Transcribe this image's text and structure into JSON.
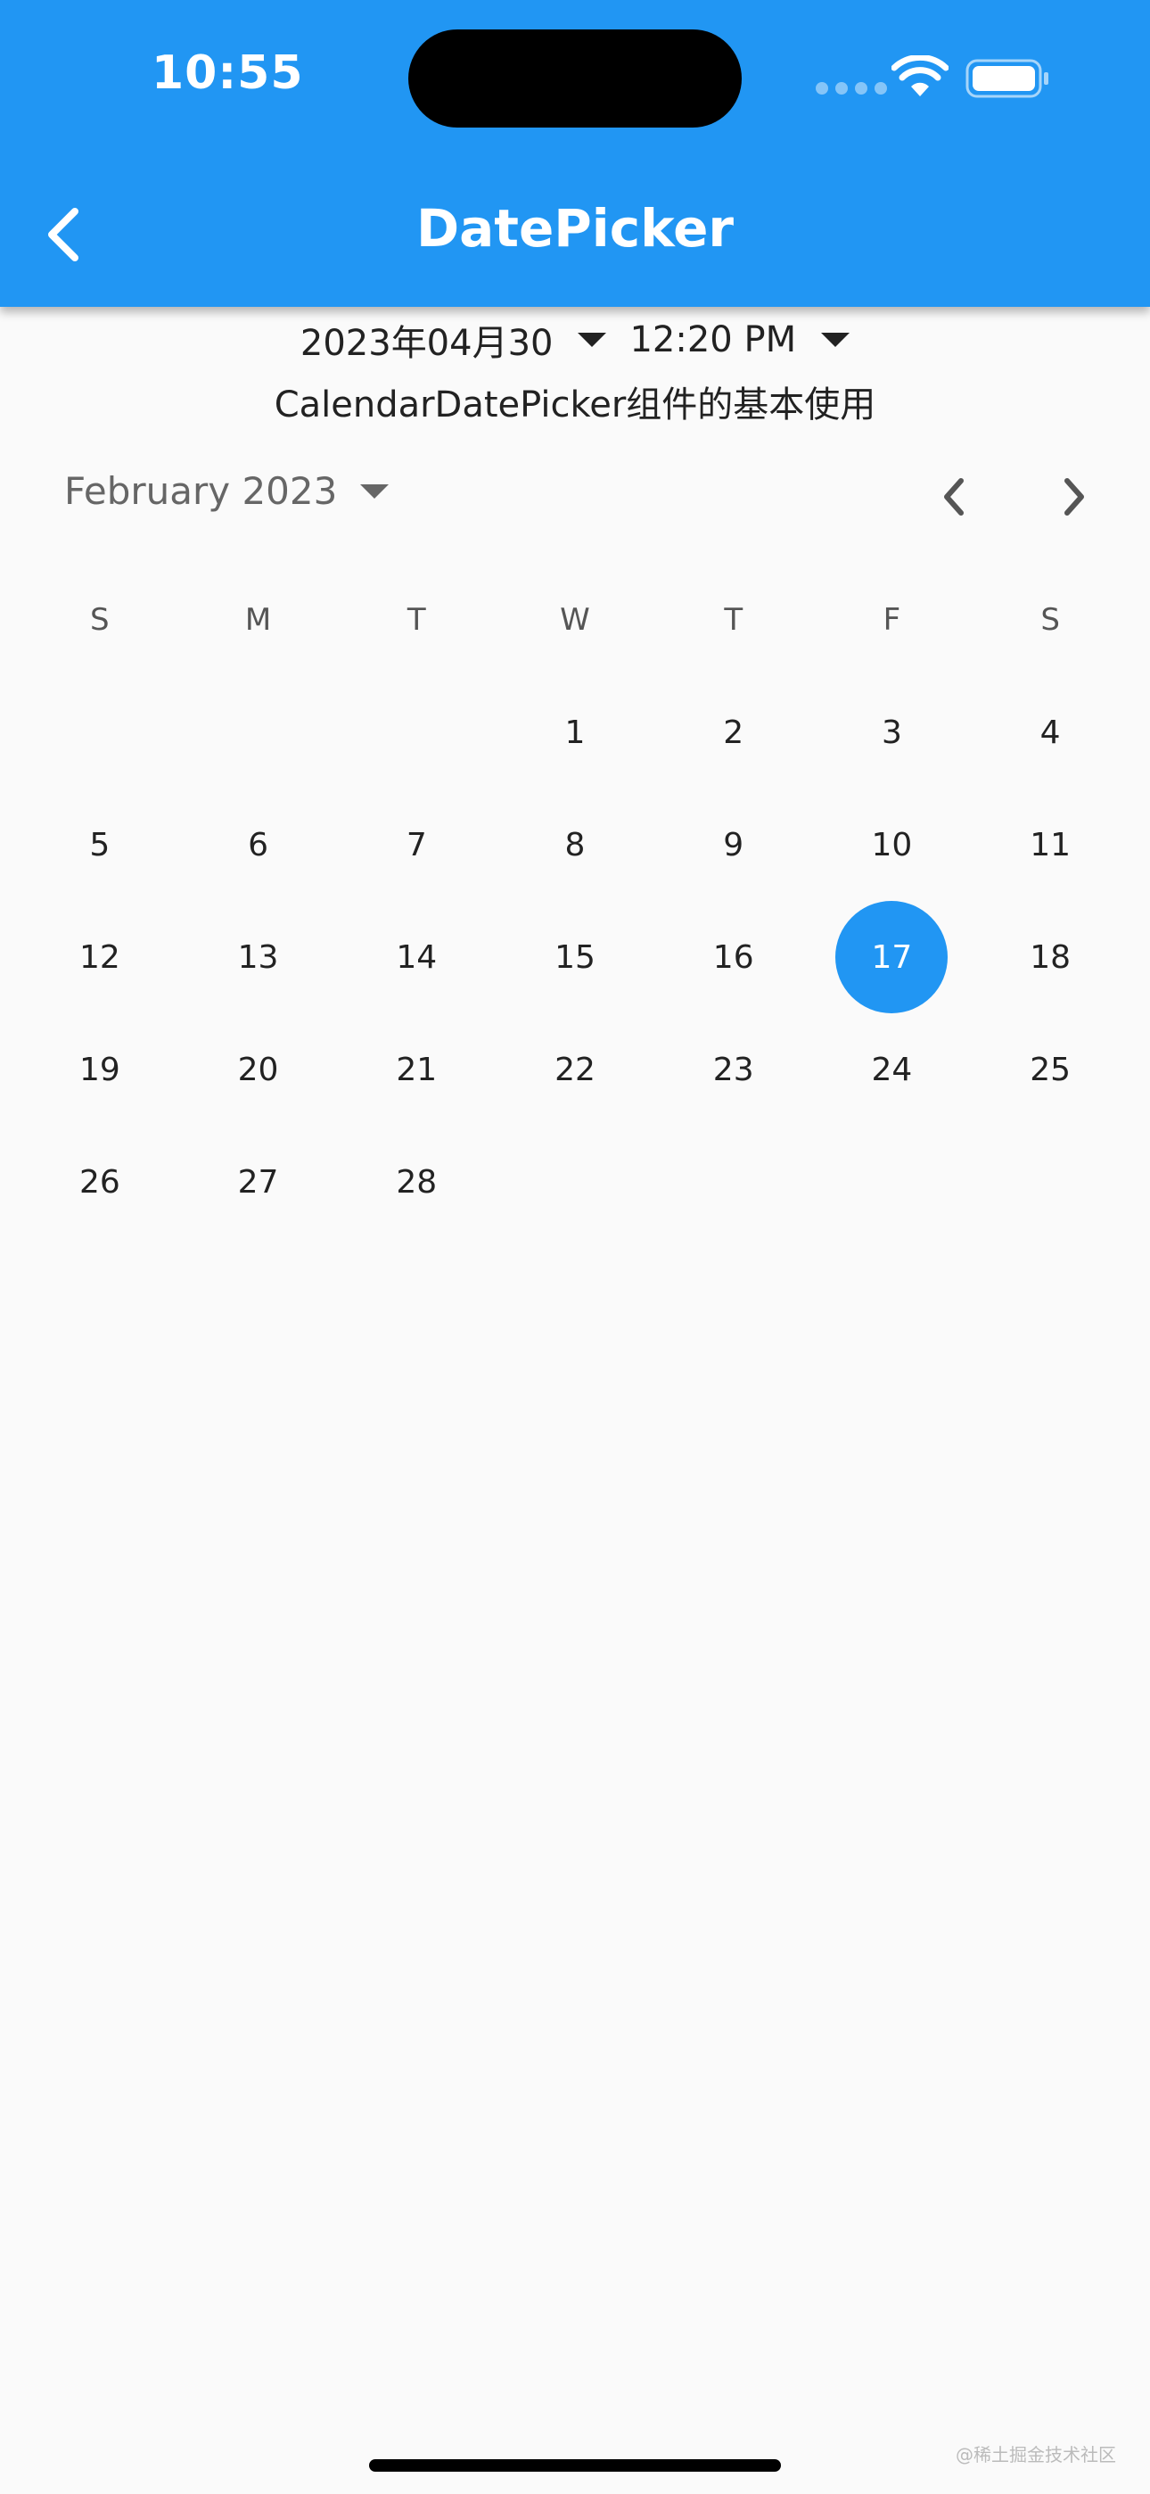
{
  "status_bar": {
    "time": "10:55"
  },
  "app_bar": {
    "title": "DatePicker"
  },
  "selection": {
    "date": "2023年04月30",
    "time": "12:20 PM"
  },
  "subtitle": "CalendarDatePicker组件的基本使用",
  "calendar": {
    "month_label": "February 2023",
    "weekdays": [
      "S",
      "M",
      "T",
      "W",
      "T",
      "F",
      "S"
    ],
    "weeks": [
      [
        "",
        "",
        "",
        "1",
        "2",
        "3",
        "4"
      ],
      [
        "5",
        "6",
        "7",
        "8",
        "9",
        "10",
        "11"
      ],
      [
        "12",
        "13",
        "14",
        "15",
        "16",
        "17",
        "18"
      ],
      [
        "19",
        "20",
        "21",
        "22",
        "23",
        "24",
        "25"
      ],
      [
        "26",
        "27",
        "28",
        "",
        "",
        "",
        ""
      ]
    ],
    "selected_day": "17"
  },
  "watermark": "@稀土掘金技术社区",
  "colors": {
    "primary": "#2196f3",
    "background": "#fafafa"
  }
}
